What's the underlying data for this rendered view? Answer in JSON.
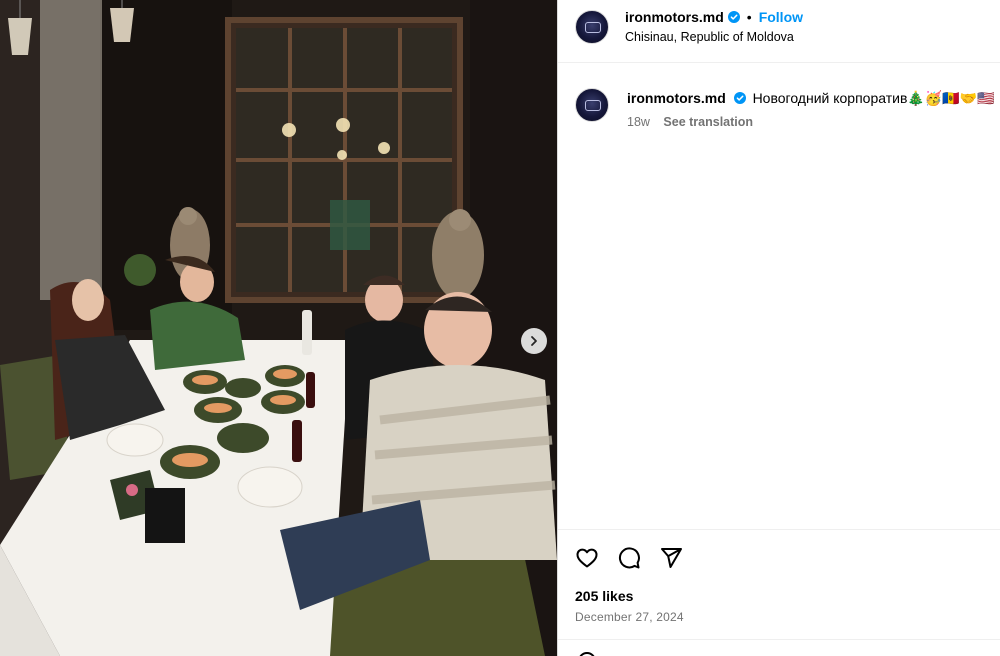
{
  "post": {
    "image_alt": "",
    "next_icon": "chevron-right-icon"
  },
  "header": {
    "username": "ironmotors.md",
    "separator": "•",
    "follow_label": "Follow",
    "location": "Chisinau, Republic of Moldova"
  },
  "caption": {
    "username": "ironmotors.md",
    "text": "Новогодний корпоратив🎄🥳🇲🇩🤝🇺🇸",
    "age": "18w",
    "translate_label": "See translation"
  },
  "actions": {
    "like_icon": "heart-icon",
    "comment_icon": "comment-icon",
    "share_icon": "share-icon"
  },
  "stats": {
    "likes": "205 likes",
    "date": "December 27, 2024"
  },
  "colors": {
    "accent": "#0095f6",
    "verified": "#0095f6",
    "muted": "#737373"
  }
}
